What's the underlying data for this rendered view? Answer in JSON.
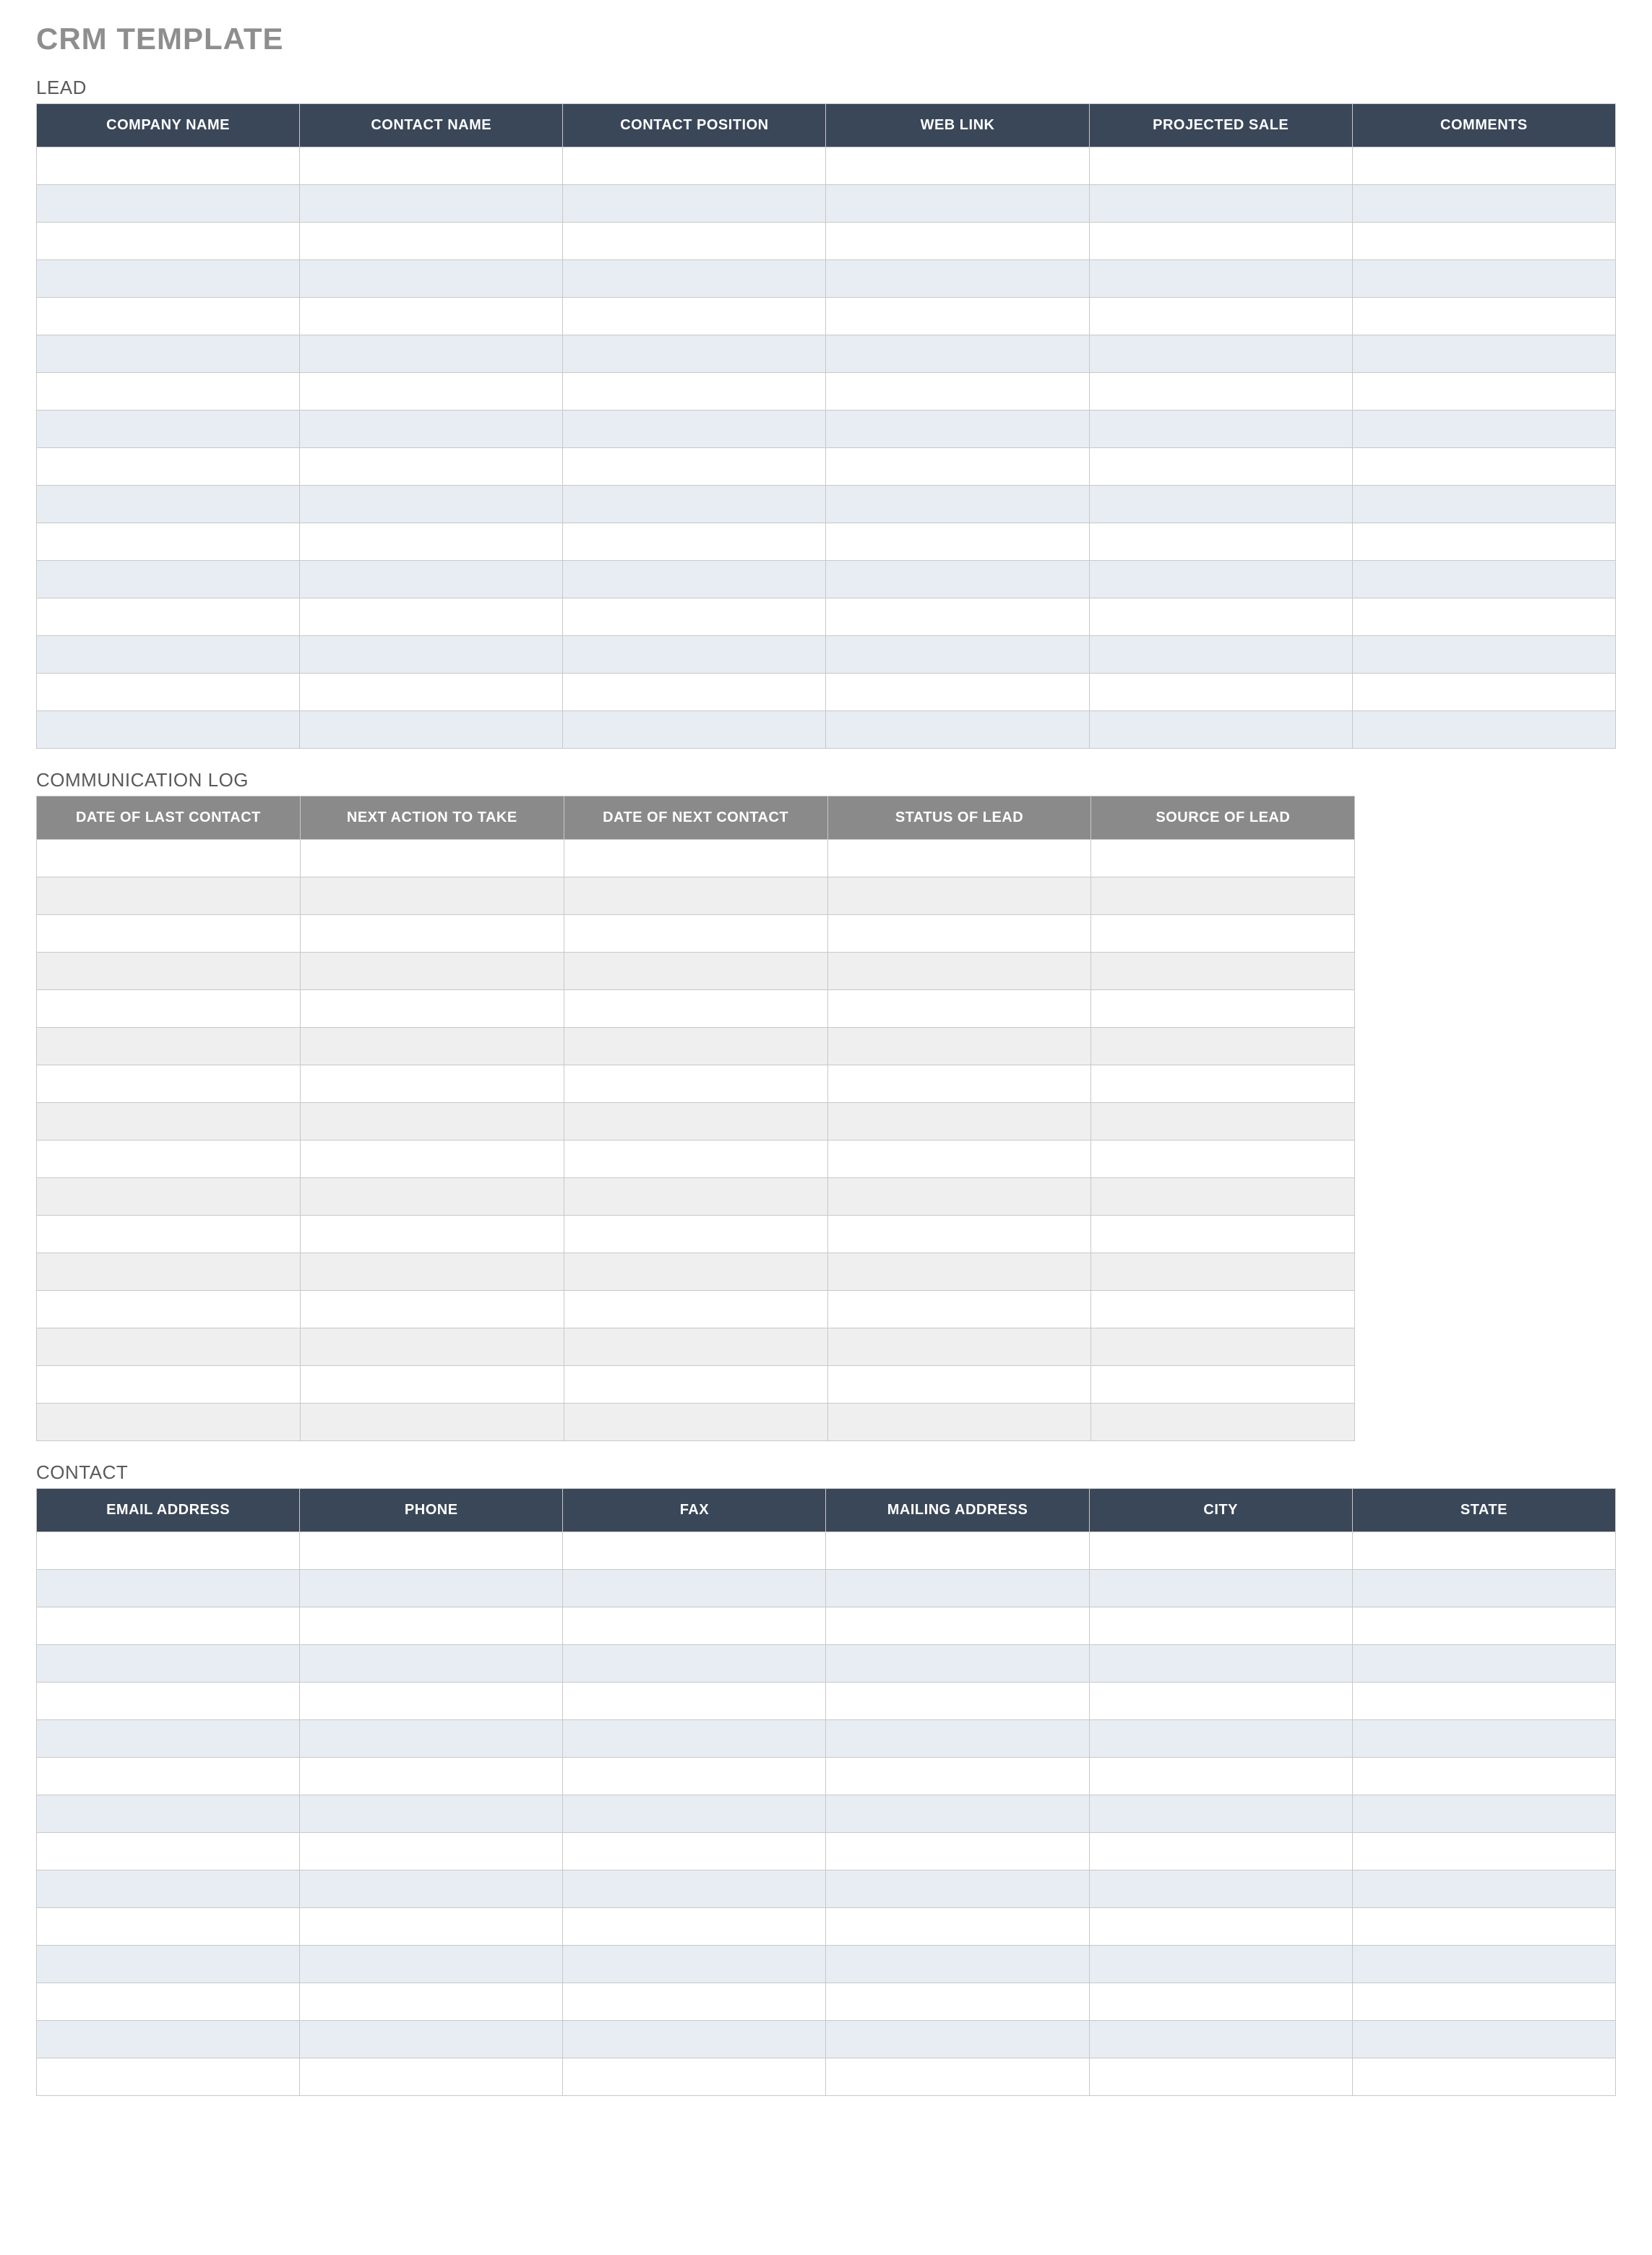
{
  "title": "CRM TEMPLATE",
  "sections": {
    "lead": {
      "label": "LEAD",
      "columns": [
        "COMPANY NAME",
        "CONTACT NAME",
        "CONTACT POSITION",
        "WEB LINK",
        "PROJECTED SALE",
        "COMMENTS"
      ],
      "row_count": 16,
      "rows": [
        [
          "",
          "",
          "",
          "",
          "",
          ""
        ],
        [
          "",
          "",
          "",
          "",
          "",
          ""
        ],
        [
          "",
          "",
          "",
          "",
          "",
          ""
        ],
        [
          "",
          "",
          "",
          "",
          "",
          ""
        ],
        [
          "",
          "",
          "",
          "",
          "",
          ""
        ],
        [
          "",
          "",
          "",
          "",
          "",
          ""
        ],
        [
          "",
          "",
          "",
          "",
          "",
          ""
        ],
        [
          "",
          "",
          "",
          "",
          "",
          ""
        ],
        [
          "",
          "",
          "",
          "",
          "",
          ""
        ],
        [
          "",
          "",
          "",
          "",
          "",
          ""
        ],
        [
          "",
          "",
          "",
          "",
          "",
          ""
        ],
        [
          "",
          "",
          "",
          "",
          "",
          ""
        ],
        [
          "",
          "",
          "",
          "",
          "",
          ""
        ],
        [
          "",
          "",
          "",
          "",
          "",
          ""
        ],
        [
          "",
          "",
          "",
          "",
          "",
          ""
        ],
        [
          "",
          "",
          "",
          "",
          "",
          ""
        ]
      ]
    },
    "commlog": {
      "label": "COMMUNICATION LOG",
      "columns": [
        "DATE OF LAST CONTACT",
        "NEXT ACTION TO TAKE",
        "DATE OF NEXT CONTACT",
        "STATUS OF LEAD",
        "SOURCE OF LEAD"
      ],
      "row_count": 16,
      "rows": [
        [
          "",
          "",
          "",
          "",
          ""
        ],
        [
          "",
          "",
          "",
          "",
          ""
        ],
        [
          "",
          "",
          "",
          "",
          ""
        ],
        [
          "",
          "",
          "",
          "",
          ""
        ],
        [
          "",
          "",
          "",
          "",
          ""
        ],
        [
          "",
          "",
          "",
          "",
          ""
        ],
        [
          "",
          "",
          "",
          "",
          ""
        ],
        [
          "",
          "",
          "",
          "",
          ""
        ],
        [
          "",
          "",
          "",
          "",
          ""
        ],
        [
          "",
          "",
          "",
          "",
          ""
        ],
        [
          "",
          "",
          "",
          "",
          ""
        ],
        [
          "",
          "",
          "",
          "",
          ""
        ],
        [
          "",
          "",
          "",
          "",
          ""
        ],
        [
          "",
          "",
          "",
          "",
          ""
        ],
        [
          "",
          "",
          "",
          "",
          ""
        ],
        [
          "",
          "",
          "",
          "",
          ""
        ]
      ]
    },
    "contact": {
      "label": "CONTACT",
      "columns": [
        "EMAIL ADDRESS",
        "PHONE",
        "FAX",
        "MAILING ADDRESS",
        "CITY",
        "STATE"
      ],
      "row_count": 15,
      "rows": [
        [
          "",
          "",
          "",
          "",
          "",
          ""
        ],
        [
          "",
          "",
          "",
          "",
          "",
          ""
        ],
        [
          "",
          "",
          "",
          "",
          "",
          ""
        ],
        [
          "",
          "",
          "",
          "",
          "",
          ""
        ],
        [
          "",
          "",
          "",
          "",
          "",
          ""
        ],
        [
          "",
          "",
          "",
          "",
          "",
          ""
        ],
        [
          "",
          "",
          "",
          "",
          "",
          ""
        ],
        [
          "",
          "",
          "",
          "",
          "",
          ""
        ],
        [
          "",
          "",
          "",
          "",
          "",
          ""
        ],
        [
          "",
          "",
          "",
          "",
          "",
          ""
        ],
        [
          "",
          "",
          "",
          "",
          "",
          ""
        ],
        [
          "",
          "",
          "",
          "",
          "",
          ""
        ],
        [
          "",
          "",
          "",
          "",
          "",
          ""
        ],
        [
          "",
          "",
          "",
          "",
          "",
          ""
        ],
        [
          "",
          "",
          "",
          "",
          "",
          ""
        ]
      ]
    }
  }
}
